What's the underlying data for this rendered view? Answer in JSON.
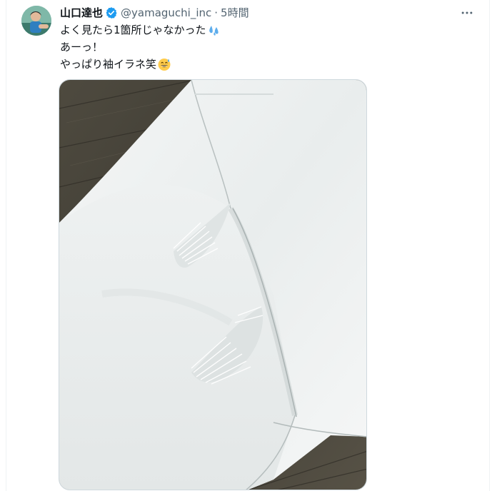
{
  "tweet": {
    "display_name": "山口達也",
    "handle": "@yamaguchi_inc",
    "separator": "·",
    "time": "5時間",
    "text_lines": [
      "よく見たら1箇所じゃなかった",
      "あーっ！",
      "やっぱり袖イラネ笑"
    ],
    "line1_emoji": "sweat-droplets",
    "line3_emoji": "grinning-face-with-sweat"
  },
  "colors": {
    "verified_blue": "#1d9bf0",
    "secondary_text": "#536471",
    "primary_text": "#0f1419"
  },
  "icons": {
    "verified": "verified-badge-icon",
    "more": "more-horizontal-icon"
  }
}
